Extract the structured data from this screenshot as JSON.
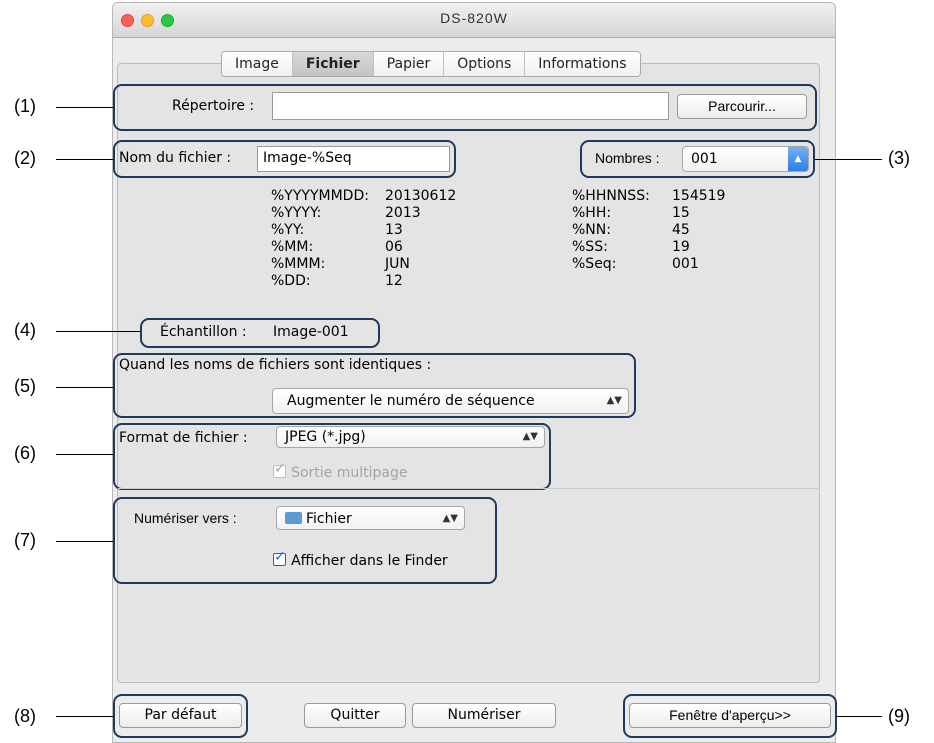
{
  "window": {
    "title": "DS-820W",
    "traffic_lights": {
      "close": "#ff5f57",
      "minimize": "#ffbd2e",
      "zoom": "#28c840"
    }
  },
  "tabs": [
    {
      "label": "Image"
    },
    {
      "label": "Fichier",
      "active": true
    },
    {
      "label": "Papier"
    },
    {
      "label": "Options"
    },
    {
      "label": "Informations"
    }
  ],
  "directory": {
    "label": "Répertoire :",
    "value": "",
    "browse_label": "Parcourir..."
  },
  "filename": {
    "label": "Nom du fichier :",
    "value": "Image-%Seq"
  },
  "numbers": {
    "label": "Nombres :",
    "value": "001"
  },
  "variables_left": [
    {
      "key": "%YYYYMMDD:",
      "value": "20130612"
    },
    {
      "key": "%YYYY:",
      "value": "2013"
    },
    {
      "key": "%YY:",
      "value": "13"
    },
    {
      "key": "%MM:",
      "value": "06"
    },
    {
      "key": "%MMM:",
      "value": "JUN"
    },
    {
      "key": "%DD:",
      "value": "12"
    }
  ],
  "variables_right": [
    {
      "key": "%HHNNSS:",
      "value": "154519"
    },
    {
      "key": "%HH:",
      "value": "15"
    },
    {
      "key": "%NN:",
      "value": "45"
    },
    {
      "key": "%SS:",
      "value": "19"
    },
    {
      "key": "%Seq:",
      "value": "001"
    }
  ],
  "sample": {
    "label": "Échantillon :",
    "value": "Image-001"
  },
  "identical": {
    "label": "Quand les noms de fichiers sont identiques :",
    "value": "Augmenter le numéro de séquence"
  },
  "file_format": {
    "label": "Format de fichier :",
    "value": "JPEG (*.jpg)",
    "multipage_label": "Sortie multipage",
    "multipage_checked": true,
    "multipage_enabled": false
  },
  "scan_to": {
    "label": "Numériser vers :",
    "value": "Fichier",
    "icon": "folder-icon",
    "finder_label": "Afficher dans le Finder",
    "finder_checked": true
  },
  "buttons": {
    "default": "Par défaut",
    "quit": "Quitter",
    "scan": "Numériser",
    "preview": "Fenêtre d'aperçu>>"
  },
  "callouts": [
    "(1)",
    "(2)",
    "(3)",
    "(4)",
    "(5)",
    "(6)",
    "(7)",
    "(8)",
    "(9)"
  ],
  "accent": "#1e3a5f"
}
